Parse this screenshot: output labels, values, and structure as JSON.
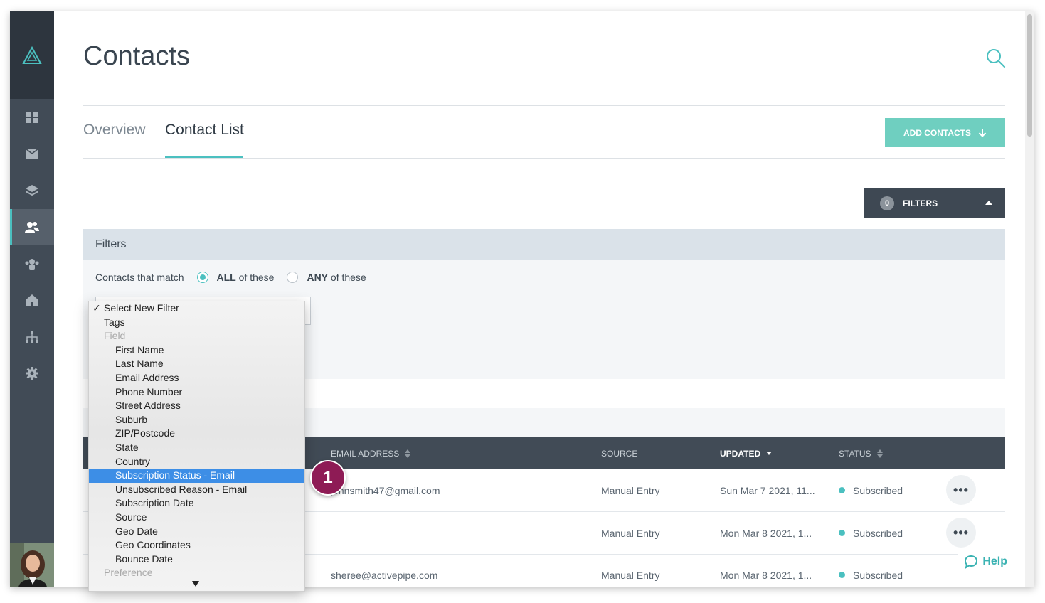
{
  "page": {
    "title": "Contacts"
  },
  "sidebar": {
    "items": [
      {
        "icon": "dashboard-icon"
      },
      {
        "icon": "mail-icon"
      },
      {
        "icon": "layers-icon"
      },
      {
        "icon": "contacts-icon",
        "active": true
      },
      {
        "icon": "groups-icon"
      },
      {
        "icon": "home-icon"
      },
      {
        "icon": "org-chart-icon"
      },
      {
        "icon": "gear-icon"
      }
    ]
  },
  "tabs": [
    {
      "label": "Overview"
    },
    {
      "label": "Contact List",
      "active": true
    }
  ],
  "actions": {
    "add_contacts": "ADD CONTACTS",
    "filters_count": "0",
    "filters_label": "FILTERS"
  },
  "filters": {
    "header": "Filters",
    "match_label": "Contacts that match",
    "all_bold": "ALL",
    "all_rest": "of these",
    "any_bold": "ANY",
    "any_rest": "of these"
  },
  "dropdown": {
    "options": [
      {
        "label": "Select New Filter",
        "checked": true
      },
      {
        "label": "Tags"
      },
      {
        "label": "Field",
        "group": true
      },
      {
        "label": "First Name",
        "indent": true
      },
      {
        "label": "Last Name",
        "indent": true
      },
      {
        "label": "Email Address",
        "indent": true
      },
      {
        "label": "Phone Number",
        "indent": true
      },
      {
        "label": "Street Address",
        "indent": true
      },
      {
        "label": "Suburb",
        "indent": true
      },
      {
        "label": "ZIP/Postcode",
        "indent": true
      },
      {
        "label": "State",
        "indent": true
      },
      {
        "label": "Country",
        "indent": true
      },
      {
        "label": "Subscription Status - Email",
        "indent": true,
        "selected": true
      },
      {
        "label": "Unsubscribed Reason - Email",
        "indent": true
      },
      {
        "label": "Subscription Date",
        "indent": true
      },
      {
        "label": "Source",
        "indent": true
      },
      {
        "label": "Geo Date",
        "indent": true
      },
      {
        "label": "Geo Coordinates",
        "indent": true
      },
      {
        "label": "Bounce Date",
        "indent": true
      },
      {
        "label": "Preference",
        "group": true
      }
    ]
  },
  "table": {
    "headers": {
      "email": "EMAIL ADDRESS",
      "source": "SOURCE",
      "updated": "UPDATED",
      "status": "STATUS"
    },
    "rows": [
      {
        "email": "johnsmith47@gmail.com",
        "source": "Manual Entry",
        "updated": "Sun Mar 7 2021, 11...",
        "status": "Subscribed"
      },
      {
        "email": "",
        "source": "Manual Entry",
        "updated": "Mon Mar 8 2021, 1...",
        "status": "Subscribed"
      },
      {
        "email": "sheree@activepipe.com",
        "source": "Manual Entry",
        "updated": "Mon Mar 8 2021, 1...",
        "status": "Subscribed"
      }
    ],
    "more_label": "•••"
  },
  "help": {
    "label": "Help"
  },
  "annotation": {
    "step": "1"
  },
  "colors": {
    "accent": "#4bc0c0",
    "sidebar": "#414b56",
    "selected_option": "#3d8ee6",
    "badge": "#8e1b55"
  }
}
